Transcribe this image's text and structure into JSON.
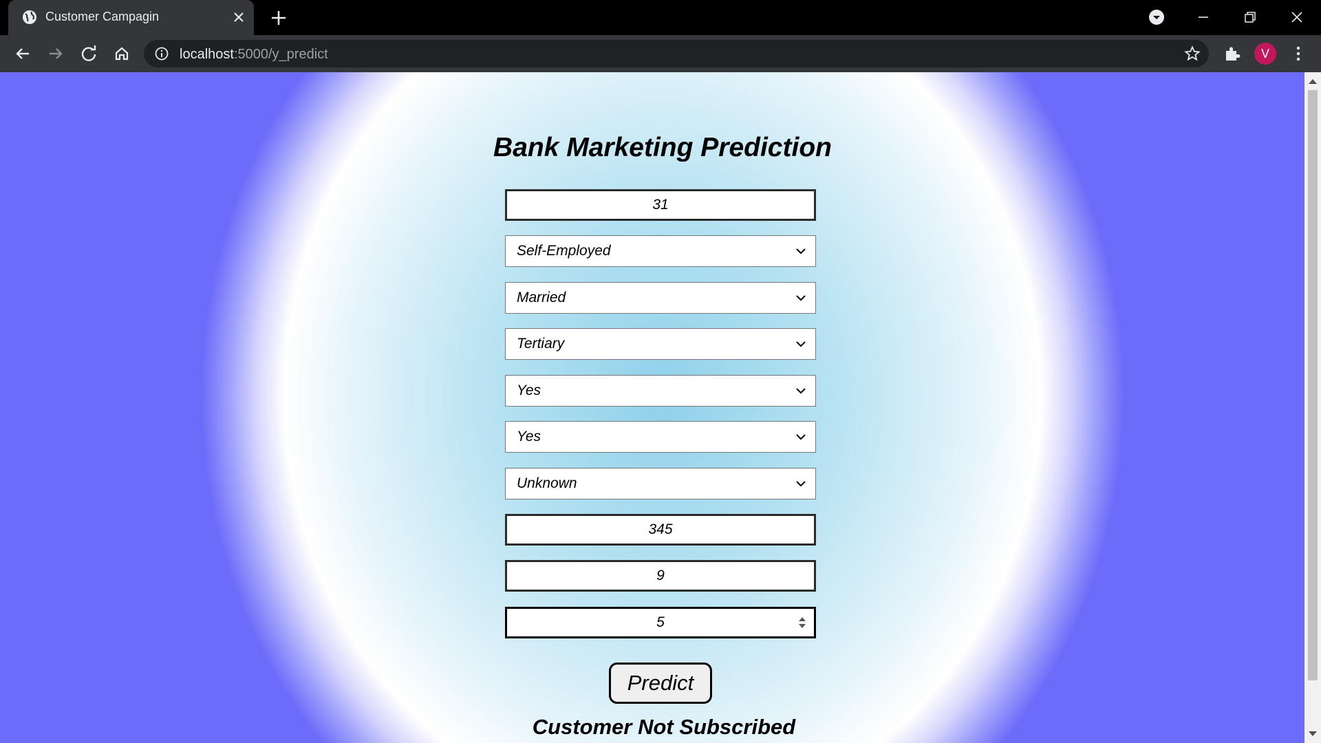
{
  "browser": {
    "tab_title": "Customer Campagin",
    "url_host": "localhost",
    "url_path": ":5000/y_predict",
    "profile_initial": "V"
  },
  "page": {
    "title": "Bank Marketing Prediction",
    "fields": {
      "age": "31",
      "job": "Self-Employed",
      "marital": "Married",
      "education": "Tertiary",
      "housing": "Yes",
      "loan": "Yes",
      "contact": "Unknown",
      "duration": "345",
      "campaign": "9",
      "pdays": "5"
    },
    "predict_label": "Predict",
    "result_text": "Customer Not Subscribed"
  },
  "colors": {
    "gradient_center": "#8fd0ea",
    "gradient_edge": "#6c6cfa",
    "profile_avatar": "#c2185b"
  }
}
